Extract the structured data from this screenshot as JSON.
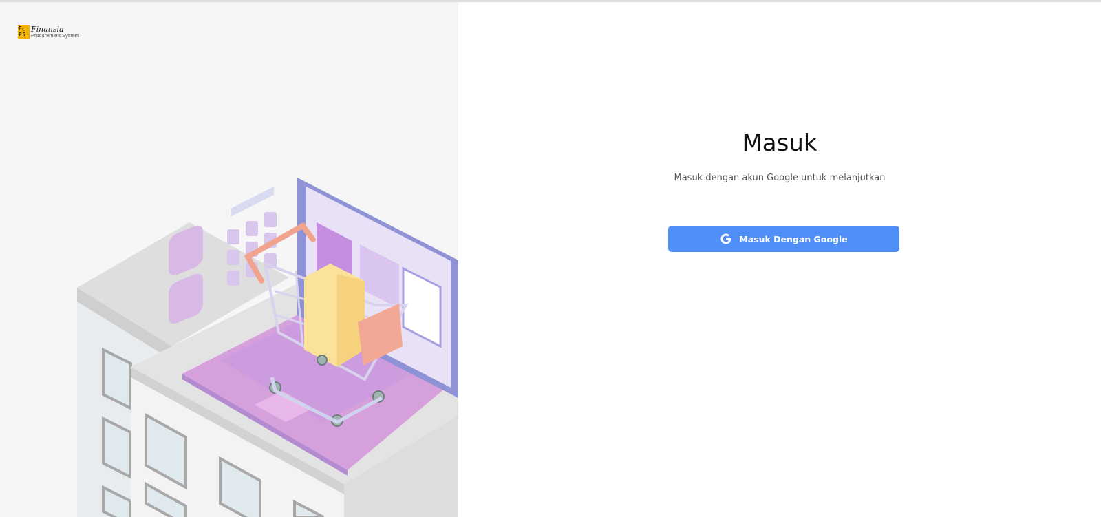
{
  "branding": {
    "logo_mark": "FP PS",
    "name": "Finansia",
    "subtitle": "Procurement System"
  },
  "illustration": {
    "icon": "shopping-cart-on-laptop-illustration"
  },
  "login": {
    "title": "Masuk",
    "subtitle": "Masuk dengan akun Google untuk melanjutkan",
    "google_button_label": "Masuk Dengan Google",
    "google_icon": "google-g-icon"
  },
  "colors": {
    "button": "#4f8ff7",
    "left_panel_bg": "#f6f6f6"
  }
}
